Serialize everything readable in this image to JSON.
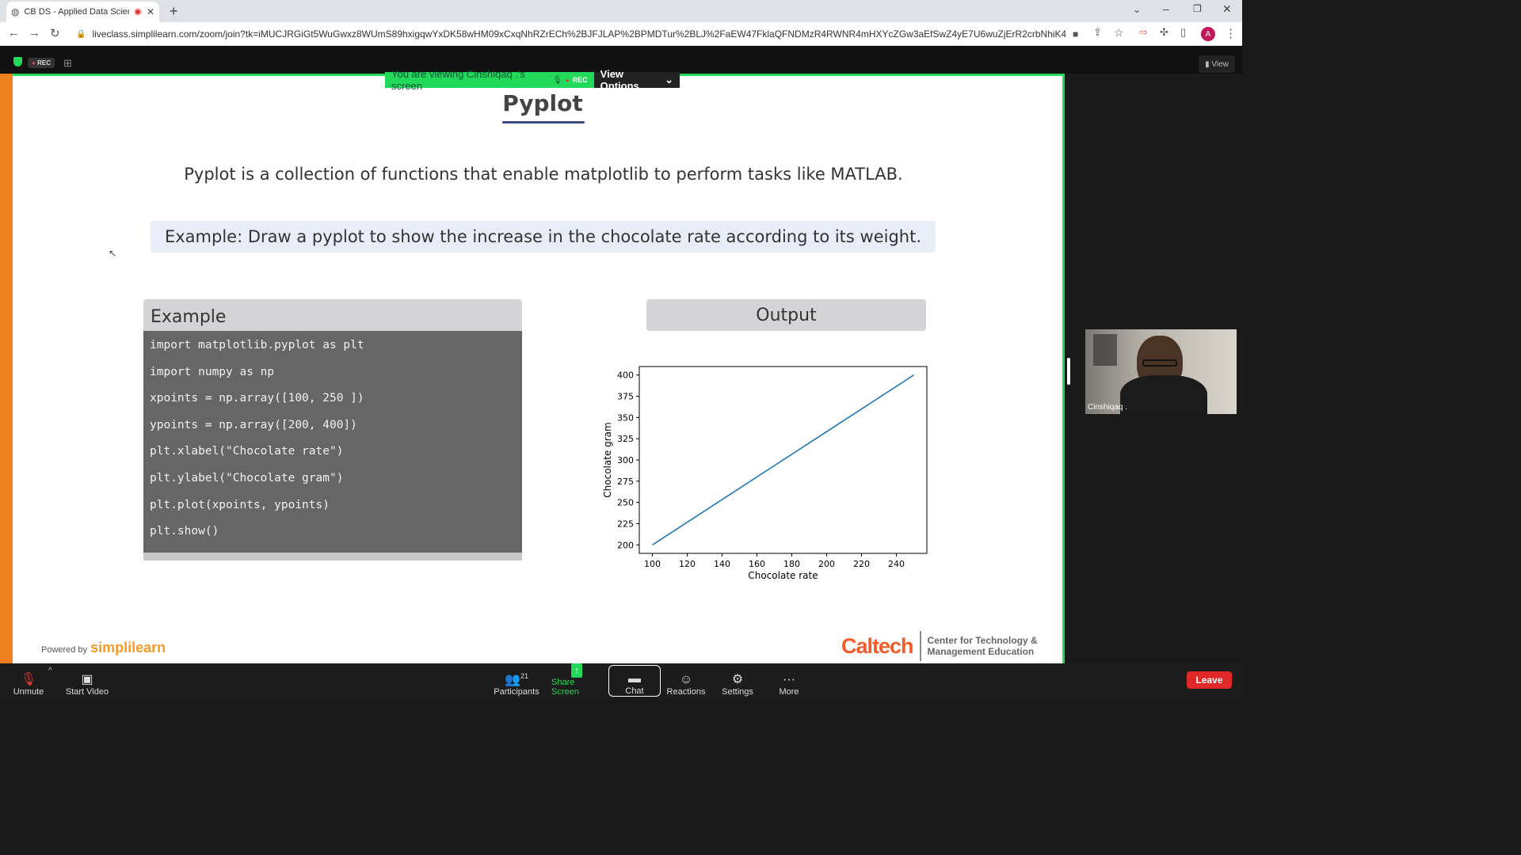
{
  "browser": {
    "tab_title": "CB DS - Applied Data Scienc",
    "url": "liveclass.simplilearn.com/zoom/join?tk=iMUCJRGiGt5WuGwxz8WUmS89hxigqwYxDK58wHM09xCxqNhRZrECh%2BJFJLAP%2BPMDTur%2BLJ%2FaEW47FklaQFNDMzR4RWNR4mHXYcZGw3aEfSwZ4yE7U6wuZjErR2crbNhiK4pN7rucDNn5pcxSOy6...",
    "profile_initial": "A"
  },
  "zoom": {
    "rec_label": "REC",
    "view_label": "View",
    "banner_text": "You are viewing Cinshiqaq .'s screen",
    "banner_rec": "REC",
    "view_options": "View Options",
    "presenter_name": "Cinshiqaq .",
    "participants_count": "21",
    "toolbar": {
      "unmute": "Unmute",
      "start_video": "Start Video",
      "participants": "Participants",
      "share_screen": "Share Screen",
      "chat": "Chat",
      "reactions": "Reactions",
      "settings": "Settings",
      "more": "More",
      "leave": "Leave"
    }
  },
  "slide": {
    "title": "Pyplot",
    "lead": "Pyplot is a collection of functions that enable matplotlib to perform tasks like MATLAB.",
    "example_prompt": "Example: Draw a pyplot to show the increase in the chocolate rate according to its weight.",
    "example_header": "Example",
    "output_header": "Output",
    "code_lines": [
      "import matplotlib.pyplot as plt",
      "import numpy as np",
      "xpoints = np.array([100, 250 ])",
      "ypoints = np.array([200, 400])",
      "plt.xlabel(\"Chocolate rate\")",
      "plt.ylabel(\"Chocolate gram\")",
      "plt.plot(xpoints, ypoints)",
      "plt.show()"
    ],
    "powered_by": "Powered by",
    "brand": "simplilearn",
    "caltech": "Caltech",
    "caltech_sub": "Center for Technology &\nManagement Education"
  },
  "chart_data": {
    "type": "line",
    "x": [
      100,
      250
    ],
    "series": [
      {
        "values": [
          200,
          400
        ]
      }
    ],
    "xlabel": "Chocolate rate",
    "ylabel": "Chocolate gram",
    "xticks": [
      100,
      120,
      140,
      160,
      180,
      200,
      220,
      240
    ],
    "yticks": [
      200,
      225,
      250,
      275,
      300,
      325,
      350,
      375,
      400
    ],
    "xlim": [
      92.5,
      257.5
    ],
    "ylim": [
      190,
      410
    ],
    "line_color": "#1f77b4",
    "grid": false
  },
  "colors": {
    "accent_green": "#23d959",
    "leave_red": "#e02828",
    "caltech_orange": "#f15a29"
  }
}
